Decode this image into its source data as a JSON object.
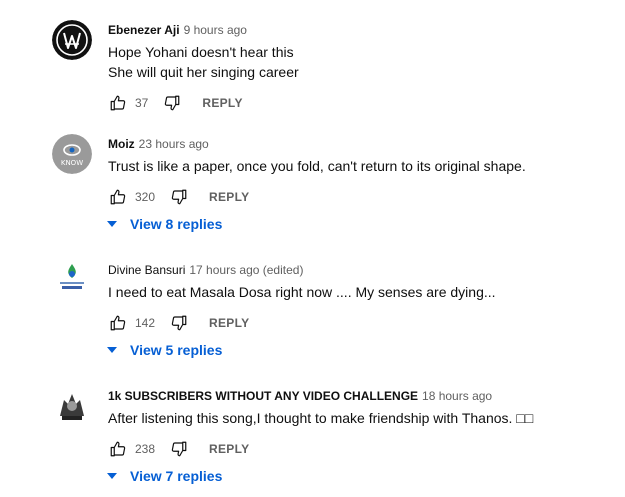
{
  "comments": [
    {
      "author": "Ebenezer Aji",
      "time": "9 hours ago",
      "text_lines": [
        "Hope Yohani doesn't hear this",
        "She will quit her singing career"
      ],
      "likes": "37",
      "reply_label": "REPLY",
      "avatar_icon": "walker-logo-icon"
    },
    {
      "author": "Moiz",
      "time": "23 hours ago",
      "text_lines": [
        "Trust is like a paper, once you fold, can't return to its original shape."
      ],
      "likes": "320",
      "reply_label": "REPLY",
      "view_replies": "View 8 replies",
      "avatar_icon": "know-logo-icon",
      "avatar_text": "KNOW"
    },
    {
      "author": "Divine Bansuri",
      "time": "17 hours ago (edited)",
      "text_lines": [
        "I need to eat Masala Dosa right now .... My senses are dying..."
      ],
      "likes": "142",
      "reply_label": "REPLY",
      "view_replies": "View 5 replies",
      "avatar_icon": "divine-bansuri-logo-icon"
    },
    {
      "author": "1k SUBSCRIBERS WITHOUT ANY VIDEO CHALLENGE",
      "time": "18 hours ago",
      "text_lines": [
        "After listening this song,I thought to make friendship with Thanos. □□"
      ],
      "likes": "238",
      "reply_label": "REPLY",
      "view_replies": "View 7 replies",
      "avatar_icon": "character-avatar-icon"
    }
  ],
  "colors": {
    "link": "#065fd4",
    "secondary": "#606060",
    "primary": "#0f0f0f"
  }
}
